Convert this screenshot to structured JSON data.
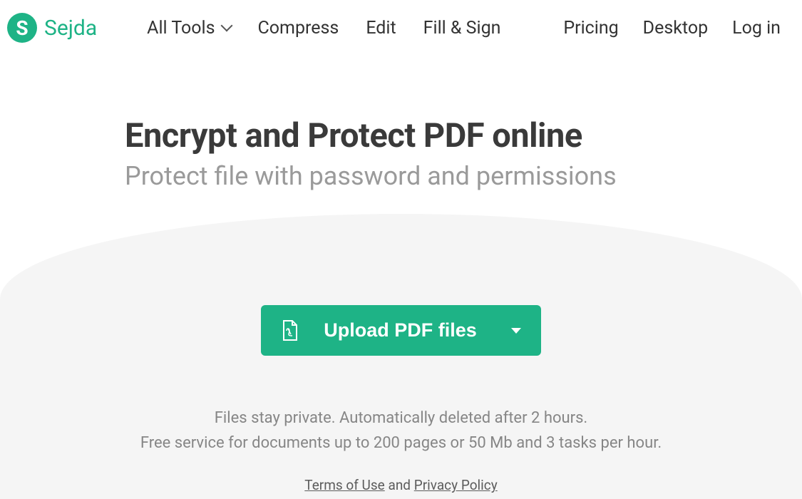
{
  "brand": {
    "logo_letter": "S",
    "name": "Sejda"
  },
  "nav": {
    "all_tools": "All Tools",
    "compress": "Compress",
    "edit": "Edit",
    "fill_sign": "Fill & Sign",
    "pricing": "Pricing",
    "desktop": "Desktop",
    "login": "Log in"
  },
  "hero": {
    "title": "Encrypt and Protect PDF online",
    "subtitle": "Protect file with password and permissions"
  },
  "upload": {
    "label": "Upload PDF files"
  },
  "info": {
    "line1": "Files stay private. Automatically deleted after 2 hours.",
    "line2": "Free service for documents up to 200 pages or 50 Mb and 3 tasks per hour."
  },
  "legal": {
    "terms": "Terms of Use",
    "and": " and ",
    "privacy": "Privacy Policy"
  }
}
